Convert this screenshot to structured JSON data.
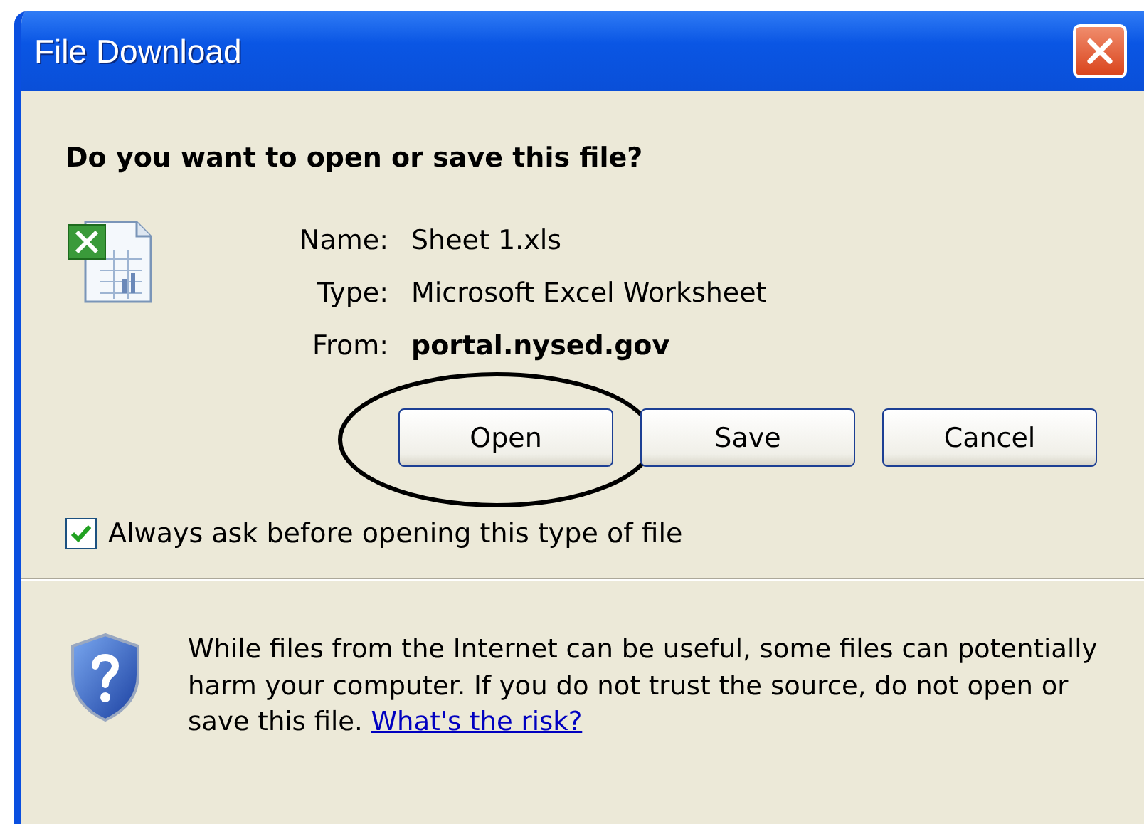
{
  "window": {
    "title": "File Download"
  },
  "question": "Do you want to open or save this file?",
  "fields": [
    {
      "label": "Name:",
      "value": "Sheet 1.xls",
      "kind": "plain"
    },
    {
      "label": "Type:",
      "value": "Microsoft Excel Worksheet",
      "kind": "plain"
    },
    {
      "label": "From:",
      "value": "portal.nysed.gov",
      "kind": "bold"
    }
  ],
  "buttons": [
    {
      "label": "Open",
      "circled": true
    },
    {
      "label": "Save",
      "circled": false
    },
    {
      "label": "Cancel",
      "circled": false
    }
  ],
  "checkbox": {
    "label": "Always ask before opening this type of file",
    "checked": true
  },
  "warning": {
    "text": "While files from the Internet can be useful, some files can potentially harm your computer. If you do not trust the source, do not open or save this file.",
    "link": "What's the risk?"
  }
}
